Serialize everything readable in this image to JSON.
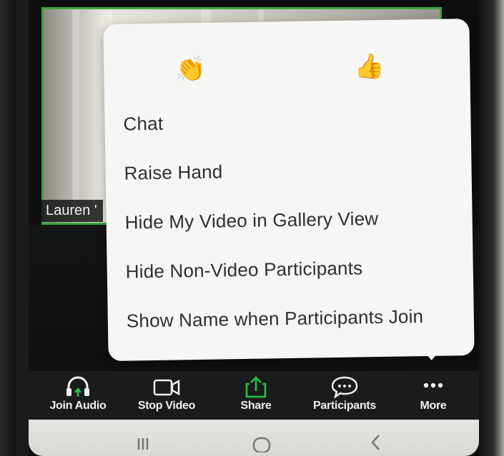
{
  "video": {
    "participant_name": "Lauren '"
  },
  "reactions": [
    {
      "icon": "clapping-hands-icon",
      "glyph": "👏"
    },
    {
      "icon": "thumbs-up-icon",
      "glyph": "👍"
    }
  ],
  "menu": {
    "items": [
      {
        "label": "Chat"
      },
      {
        "label": "Raise Hand"
      },
      {
        "label": "Hide My Video in Gallery View"
      },
      {
        "label": "Hide Non-Video Participants"
      },
      {
        "label": "Show Name when Participants Join"
      }
    ]
  },
  "toolbar": {
    "join_audio": "Join Audio",
    "stop_video": "Stop Video",
    "share": "Share",
    "participants": "Participants",
    "more": "More"
  },
  "colors": {
    "accent_green": "#3aa540",
    "share_green": "#26c24a",
    "menu_bg": "#f6f6f4",
    "toolbar_bg": "#1a1c1b"
  }
}
